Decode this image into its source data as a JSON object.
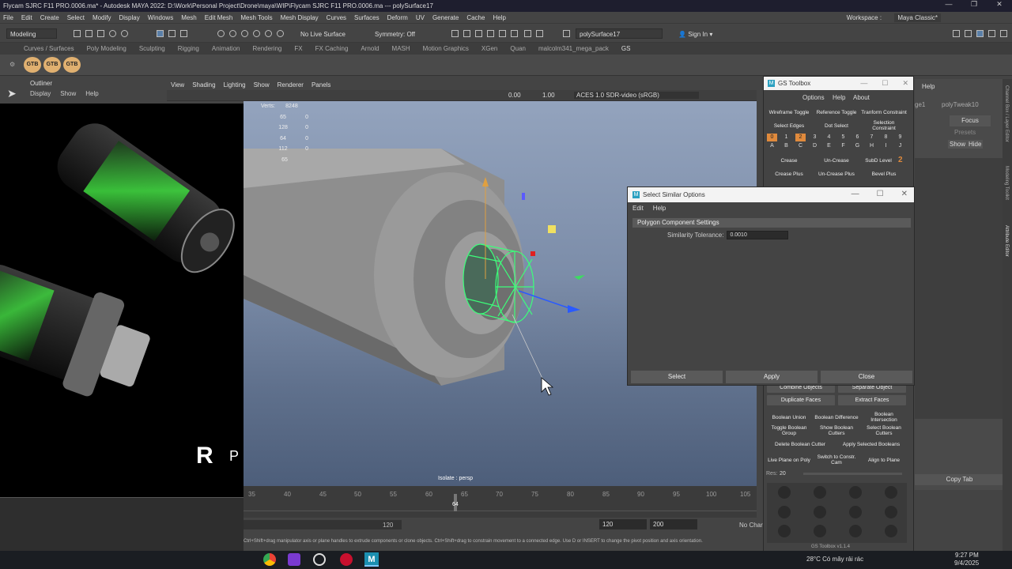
{
  "title_bar": {
    "text": "Flycam SJRC F11 PRO.0006.ma* - Autodesk MAYA 2022: D:\\Work\\Personal Project\\Drone\\maya\\WIP\\Flycam SJRC F11 PRO.0006.ma  ---  polySurface17"
  },
  "menu": [
    "File",
    "Edit",
    "Create",
    "Select",
    "Modify",
    "Display",
    "Windows",
    "Mesh",
    "Edit Mesh",
    "Mesh Tools",
    "Mesh Display",
    "Curves",
    "Surfaces",
    "Deform",
    "UV",
    "Generate",
    "Cache",
    "Help"
  ],
  "workspace": {
    "label": "Workspace :",
    "value": "Maya Classic*"
  },
  "status_line": {
    "mode": "Modeling",
    "live_surface": "No Live Surface",
    "symmetry": "Symmetry: Off",
    "object_name": "polySurface17",
    "sign_in": "Sign In"
  },
  "shelf_tabs": [
    "Curves / Surfaces",
    "Poly Modeling",
    "Sculpting",
    "Rigging",
    "Animation",
    "Rendering",
    "FX",
    "FX Caching",
    "Arnold",
    "MASH",
    "Motion Graphics",
    "XGen",
    "Quan",
    "malcolm341_mega_pack",
    "GS"
  ],
  "shelf_active": "GS",
  "shelf_icons": [
    "GTB",
    "GTB",
    "GTB"
  ],
  "outliner": {
    "title": "Outliner",
    "menu": [
      "Display",
      "Show",
      "Help"
    ]
  },
  "panel_menu": [
    "View",
    "Shading",
    "Lighting",
    "Show",
    "Renderer",
    "Panels"
  ],
  "panel_toolbar": {
    "val1": "0.00",
    "val2": "1.00",
    "colorspace": "ACES 1.0 SDR-video (sRGB)"
  },
  "hud": [
    {
      "label": "Verts:",
      "a": "8248",
      "b": ""
    },
    {
      "label": "",
      "a": "65",
      "b": "0"
    },
    {
      "label": "",
      "a": "128",
      "b": "0"
    },
    {
      "label": "",
      "a": "64",
      "b": "0"
    },
    {
      "label": "",
      "a": "112",
      "b": "0"
    },
    {
      "label": "",
      "a": "65",
      "b": ""
    }
  ],
  "viewport_label": "Isolate : persp",
  "timeline": {
    "ticks": [
      "35",
      "40",
      "45",
      "50",
      "55",
      "60",
      "65",
      "70",
      "75",
      "80",
      "85",
      "90",
      "95",
      "100",
      "105"
    ],
    "current": "64"
  },
  "range": {
    "end_a": "120",
    "end_b": "120",
    "max": "200",
    "char_set": "No Char"
  },
  "help_line": "Ctrl+Shift+drag manipulator axis or plane handles to extrude components or clone objects. Ctrl+Shift+drag to constrain movement to a connected edge. Use D or INSERT to change the pivot position and axis orientation.",
  "gs_toolbox": {
    "title": "GS Toolbox",
    "menu": [
      "Options",
      "Help",
      "About"
    ],
    "row1": [
      "Wireframe Toggle",
      "Reference Toggle",
      "Tranform Constraint"
    ],
    "row2": [
      "Select Edges",
      "Dot Select",
      "Selection Constraint"
    ],
    "numbers": [
      "0",
      "1",
      "2",
      "3",
      "4",
      "5",
      "6",
      "7",
      "8",
      "9"
    ],
    "letters": [
      "A",
      "B",
      "C",
      "D",
      "E",
      "F",
      "G",
      "H",
      "I",
      "J"
    ],
    "row3": [
      "Crease",
      "Un-Crease",
      "SubD Level"
    ],
    "subd_value": "2",
    "row4": [
      "Crease Plus",
      "Un-Crease Plus",
      "Bevel Plus"
    ],
    "partial": [
      "Combine Objects",
      "Separate Object"
    ],
    "row5": [
      "Duplicate Faces",
      "Extract Faces"
    ],
    "row6": [
      "Boolean Union",
      "Boolean Difference",
      "Boolean Intersection"
    ],
    "row7": [
      "Toggle Boolean Group",
      "Show Boolean Cutters",
      "Select Boolean Cutters"
    ],
    "row8": [
      "Delete Boolean Cutter",
      "Apply Selected Booleans"
    ],
    "row9": [
      "Live Plane on Poly",
      "Switch to Constr. Cam",
      "Align to Plane"
    ],
    "res_label": "Res:",
    "res_value": "20",
    "version": "GS Toolbox v1.1.4"
  },
  "right_panel": {
    "help": "Help",
    "tab": "polyTweak10",
    "tab_partial": "ge1",
    "focus": "Focus",
    "presets": "Presets",
    "show": "Show",
    "hide": "Hide",
    "copy_tab": "Copy Tab"
  },
  "side_tabs": [
    "Channel Box / Layer Editor",
    "Modeling Toolkit",
    "Attribute Editor"
  ],
  "dialog": {
    "title": "Select Similar Options",
    "menu": [
      "Edit",
      "Help"
    ],
    "section": "Polygon Component Settings",
    "field_label": "Similarity Tolerance:",
    "field_value": "0.0010",
    "buttons": [
      "Select",
      "Apply",
      "Close"
    ]
  },
  "taskbar": {
    "weather": "28°C  Có mây rải rác",
    "time": "9:27 PM",
    "date": "9/4/2025"
  },
  "colors": {
    "accent_orange": "#e08a3c",
    "selection_green": "#3cff7a",
    "viewport_top": "#93a3bd"
  }
}
